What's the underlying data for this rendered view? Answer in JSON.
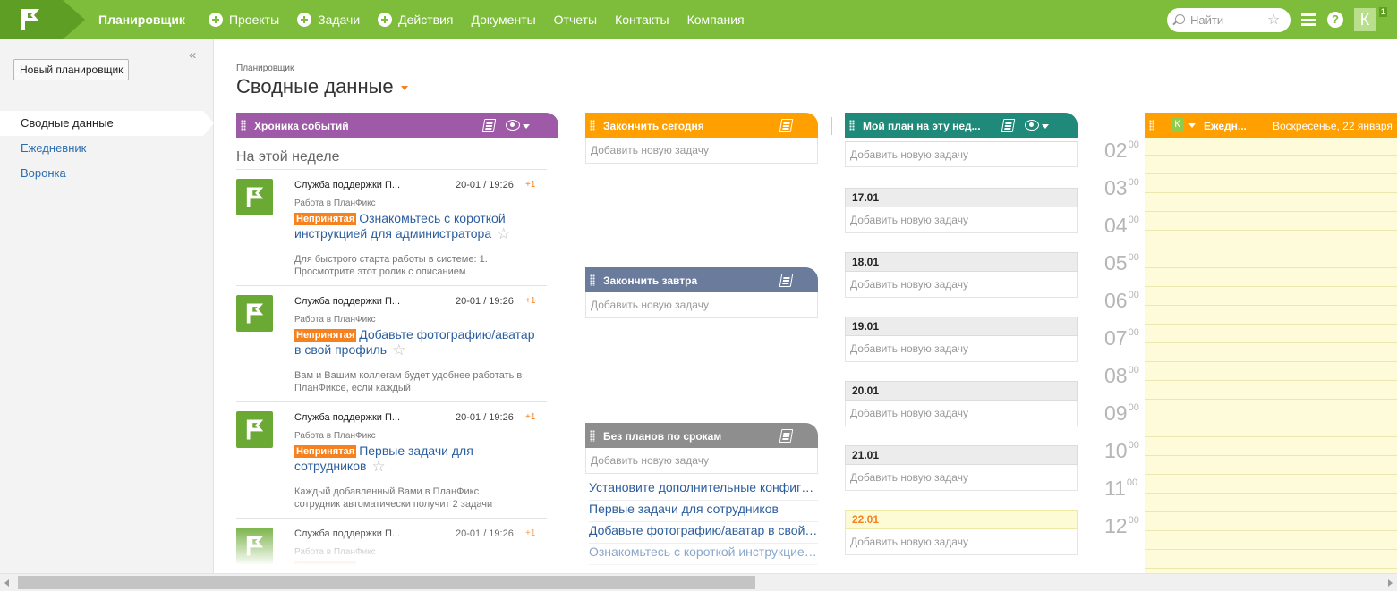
{
  "topbar": {
    "nav": [
      {
        "label": "Планировщик",
        "active": true
      },
      {
        "label": "Проекты",
        "plus": true
      },
      {
        "label": "Задачи",
        "plus": true
      },
      {
        "label": "Действия",
        "plus": true
      },
      {
        "label": "Документы"
      },
      {
        "label": "Отчеты"
      },
      {
        "label": "Контакты"
      },
      {
        "label": "Компания"
      }
    ],
    "search_placeholder": "Найти",
    "user_initial": "К",
    "notification_count": "1",
    "colors": {
      "bar": "#7dbd3b",
      "logo": "#5e9e24"
    }
  },
  "sidebar": {
    "new_button": "Новый планировщик",
    "items": [
      {
        "label": "Сводные данные",
        "active": true
      },
      {
        "label": "Ежедневник"
      },
      {
        "label": "Воронка"
      }
    ]
  },
  "header": {
    "breadcrumb": "Планировщик",
    "title": "Сводные данные"
  },
  "feed": {
    "header": "Хроника событий",
    "color": "#9e5aa6",
    "section_title": "На этой неделе",
    "items": [
      {
        "author": "Служба поддержки П...",
        "time": "20-01 / 19:26",
        "count": "+1",
        "project": "Работа в ПланФикс",
        "status": "Непринятая",
        "title": "Ознакомьтесь с короткой инструкцией для администратора",
        "description": "Для быстрого старта работы в системе: 1. Просмотрите этот ролик с описанием"
      },
      {
        "author": "Служба поддержки П...",
        "time": "20-01 / 19:26",
        "count": "+1",
        "project": "Работа в ПланФикс",
        "status": "Непринятая",
        "title": "Добавьте фотографию/аватар в свой профиль",
        "description": "Вам и Вашим коллегам будет удобнее работать в ПланФиксе, если каждый"
      },
      {
        "author": "Служба поддержки П...",
        "time": "20-01 / 19:26",
        "count": "+1",
        "project": "Работа в ПланФикс",
        "status": "Непринятая",
        "title": "Первые задачи для сотрудников",
        "description": "Каждый добавленный Вами в ПланФикс сотрудник автоматически получит 2 задачи"
      },
      {
        "author": "Служба поддержки П...",
        "time": "20-01 / 19:26",
        "count": "+1",
        "project": "Работа в ПланФикс",
        "status": "Непринятая",
        "title": "",
        "description": ""
      }
    ]
  },
  "columns": {
    "add_task": "Добавить новую задачу",
    "today": {
      "title": "Закончить сегодня",
      "color": "#ff9f00"
    },
    "tomorrow": {
      "title": "Закончить завтра",
      "color": "#6b7b9c"
    },
    "no_deadline": {
      "title": "Без планов по срокам",
      "color": "#8e8e8e",
      "tasks": [
        "Установите дополнительные конфигурации",
        "Первые задачи для сотрудников",
        "Добавьте фотографию/аватар в свой профиль",
        "Ознакомьтесь с короткой инструкцией для администратора"
      ]
    },
    "week_plan": {
      "title": "Мой план на эту нед...",
      "color": "#1f8a79",
      "days": [
        {
          "date": "17.01"
        },
        {
          "date": "18.01"
        },
        {
          "date": "19.01"
        },
        {
          "date": "20.01"
        },
        {
          "date": "21.01"
        },
        {
          "date": "22.01",
          "today": true
        }
      ]
    }
  },
  "diary": {
    "initial": "К",
    "title": "Ежедн...",
    "date": "Воскресенье, 22 января",
    "color": "#ff9f00",
    "hours": [
      "02",
      "03",
      "04",
      "05",
      "06",
      "07",
      "08",
      "09",
      "10",
      "11",
      "12"
    ],
    "minutes": "00"
  }
}
